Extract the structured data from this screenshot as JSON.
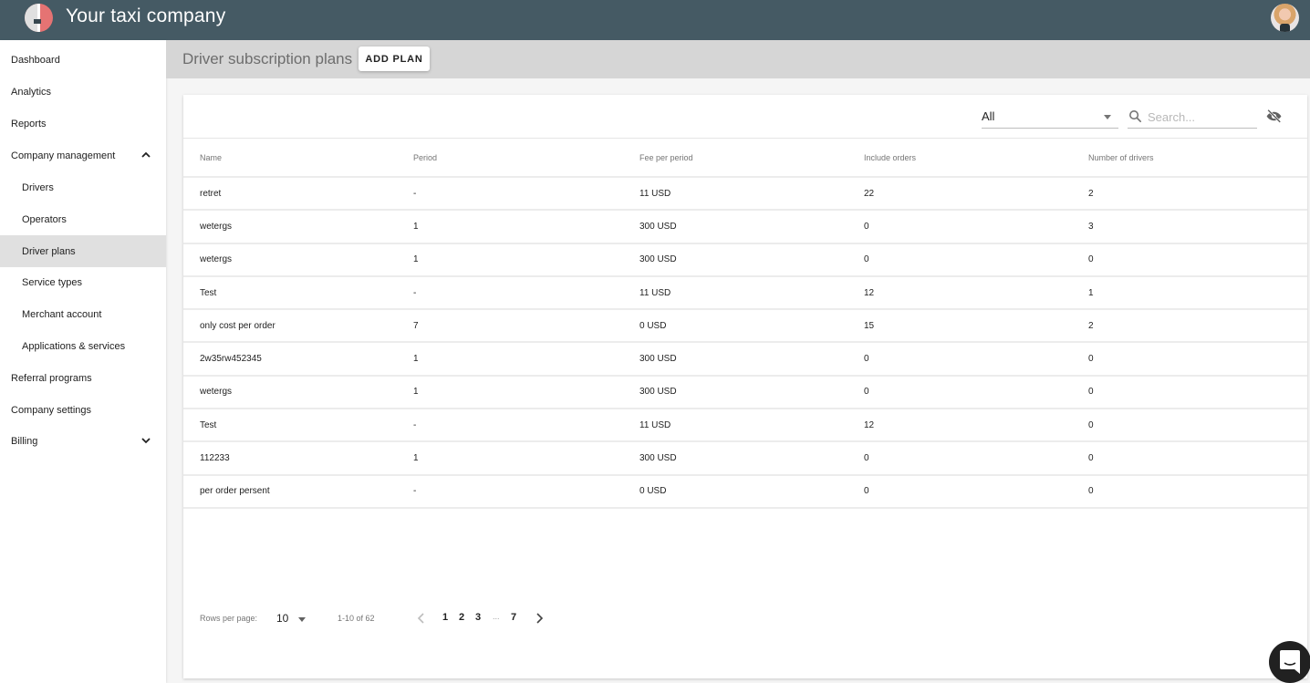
{
  "app": {
    "title": "Your taxi company",
    "logo_icon": "taxi-logo",
    "avatar_icon": "user-avatar"
  },
  "sidebar": {
    "items": [
      {
        "label": "Dashboard",
        "level": "top"
      },
      {
        "label": "Analytics",
        "level": "top"
      },
      {
        "label": "Reports",
        "level": "top"
      },
      {
        "label": "Company management",
        "level": "top",
        "chevron": "chevron-up-icon",
        "expanded": true
      },
      {
        "label": "Drivers",
        "level": "sub"
      },
      {
        "label": "Operators",
        "level": "sub"
      },
      {
        "label": "Driver plans",
        "level": "sub",
        "active": true
      },
      {
        "label": "Service types",
        "level": "sub"
      },
      {
        "label": "Merchant account",
        "level": "sub"
      },
      {
        "label": "Applications & services",
        "level": "sub"
      },
      {
        "label": "Referral programs",
        "level": "top"
      },
      {
        "label": "Company settings",
        "level": "top"
      },
      {
        "label": "Billing",
        "level": "top",
        "chevron": "chevron-down-icon",
        "expanded": false
      }
    ]
  },
  "page": {
    "title": "Driver subscription plans",
    "add_button_label": "ADD PLAN"
  },
  "filters": {
    "select_value": "All",
    "search_placeholder": "Search...",
    "search_value": "",
    "visibility_icon": "visibility-off-icon"
  },
  "table": {
    "columns": [
      "Name",
      "Period",
      "Fee per period",
      "Include orders",
      "Number of drivers"
    ],
    "rows": [
      [
        "retret",
        "-",
        "11 USD",
        "22",
        "2"
      ],
      [
        "wetergs",
        "1",
        "300 USD",
        "0",
        "3"
      ],
      [
        "wetergs",
        "1",
        "300 USD",
        "0",
        "0"
      ],
      [
        "Test",
        "-",
        "11 USD",
        "12",
        "1"
      ],
      [
        "only cost per order",
        "7",
        "0 USD",
        "15",
        "2"
      ],
      [
        "2w35rw452345",
        "1",
        "300 USD",
        "0",
        "0"
      ],
      [
        "wetergs",
        "1",
        "300 USD",
        "0",
        "0"
      ],
      [
        "Test",
        "-",
        "11 USD",
        "12",
        "0"
      ],
      [
        "112233",
        "1",
        "300 USD",
        "0",
        "0"
      ],
      [
        "per order persent",
        "-",
        "0 USD",
        "0",
        "0"
      ]
    ]
  },
  "pagination": {
    "rows_per_page_label": "Rows per page:",
    "rows_per_page": "10",
    "range_text": "1-10 of 62",
    "pages": [
      "1",
      "2",
      "3",
      "7"
    ],
    "ellipsis": "...",
    "current_page": "1"
  },
  "chat": {
    "icon": "chat-icon"
  },
  "colors": {
    "appbar": "#455a64",
    "page_header": "#d6d6d6",
    "active_nav": "#e0e0e0",
    "chat_fab": "#212121"
  }
}
